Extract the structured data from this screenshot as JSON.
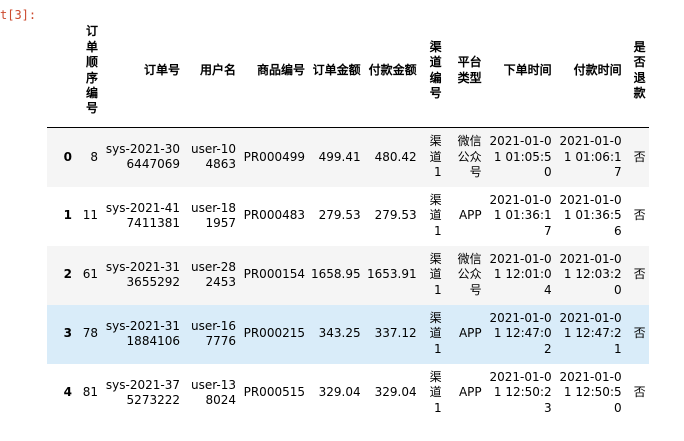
{
  "prompt": "t[3]:",
  "columns": [
    "",
    "订单顺序编号",
    "订单号",
    "用户名",
    "商品编号",
    "订单金额",
    "付款金额",
    "渠道编号",
    "平台类型",
    "下单时间",
    "付款时间",
    "是否退款"
  ],
  "rows": [
    [
      "0",
      "8",
      "sys-2021-306447069",
      "user-104863",
      "PR000499",
      "499.41",
      "480.42",
      "渠道1",
      "微信公众号",
      "2021-01-01 01:05:50",
      "2021-01-01 01:06:17",
      "否"
    ],
    [
      "1",
      "11",
      "sys-2021-417411381",
      "user-181957",
      "PR000483",
      "279.53",
      "279.53",
      "渠道1",
      "APP",
      "2021-01-01 01:36:17",
      "2021-01-01 01:36:56",
      "否"
    ],
    [
      "2",
      "61",
      "sys-2021-313655292",
      "user-282453",
      "PR000154",
      "1658.95",
      "1653.91",
      "渠道1",
      "微信公众号",
      "2021-01-01 12:01:04",
      "2021-01-01 12:03:20",
      "否"
    ],
    [
      "3",
      "78",
      "sys-2021-311884106",
      "user-167776",
      "PR000215",
      "343.25",
      "337.12",
      "渠道1",
      "APP",
      "2021-01-01 12:47:02",
      "2021-01-01 12:47:21",
      "否"
    ],
    [
      "4",
      "81",
      "sys-2021-375273222",
      "user-138024",
      "PR000515",
      "329.04",
      "329.04",
      "渠道1",
      "APP",
      "2021-01-01 12:50:23",
      "2021-01-01 12:50:50",
      "否"
    ]
  ]
}
